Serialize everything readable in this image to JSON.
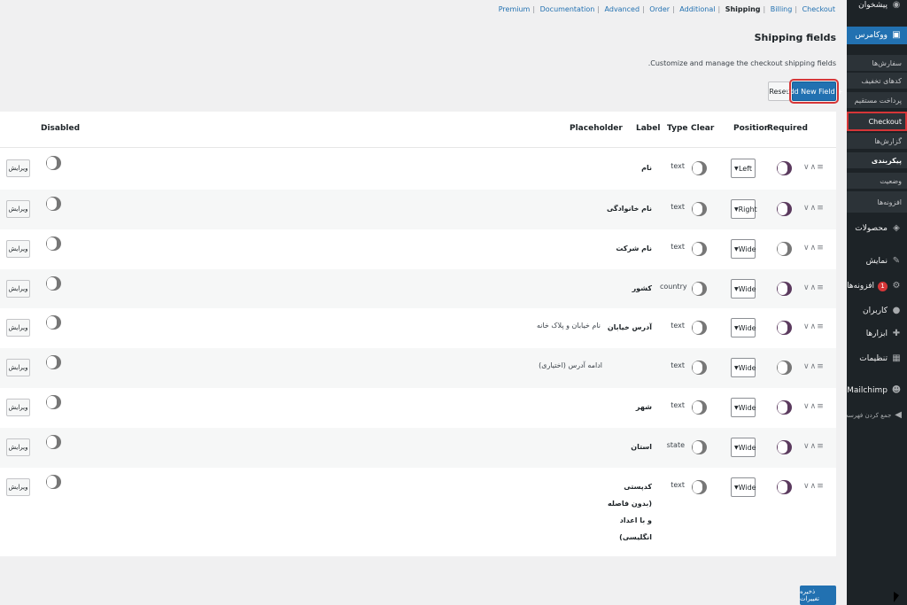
{
  "sidebar": {
    "top_item": "پیشخوان",
    "woo": "ووکامرس",
    "woo_sub": [
      "سفارش‌ها",
      "کدهای تخفیف",
      "پرداخت مستقیم",
      "Checkout",
      "گزارش‌ها",
      "پیکربندی",
      "وضعیت",
      "افزونه‌ها"
    ],
    "menu": [
      {
        "label": "محصولات",
        "icon": "archive-icon"
      },
      {
        "label": "نمایش",
        "icon": "brush-icon"
      },
      {
        "label": "افزونه‌ها",
        "icon": "plugin-icon",
        "badge": "1"
      },
      {
        "label": "کاربران",
        "icon": "user-icon"
      },
      {
        "label": "ابزارها",
        "icon": "wrench-icon"
      },
      {
        "label": "تنظیمات",
        "icon": "settings-icon"
      },
      {
        "label": "Mailchimp",
        "icon": "mailchimp-icon"
      },
      {
        "label": "جمع کردن فهرست",
        "icon": "collapse-icon"
      }
    ]
  },
  "nav": {
    "links": [
      "Premium",
      "Documentation",
      "Advanced",
      "Order",
      "Additional",
      "Shipping",
      "Billing",
      "Checkout"
    ],
    "current": "Shipping"
  },
  "page": {
    "title": "Shipping fields",
    "description": ".Customize and manage the checkout shipping fields",
    "reset": "Reset",
    "add_new": "Add New Field +",
    "save": "ذخیره تغییرات"
  },
  "table": {
    "headers": {
      "disabled": "Disabled",
      "placeholder": "Placeholder",
      "label": "Label",
      "type": "Type",
      "clear": "Clear",
      "position": "Position",
      "required": "Required"
    },
    "edit_label": "ویرایش",
    "rows": [
      {
        "label": "نام",
        "placeholder": "",
        "type": "text",
        "position": "Left",
        "required": true
      },
      {
        "label": "نام خانوادگی",
        "placeholder": "",
        "type": "text",
        "position": "Right",
        "required": true
      },
      {
        "label": "نام شرکت",
        "placeholder": "",
        "type": "text",
        "position": "Wide",
        "required": false
      },
      {
        "label": "کشور",
        "placeholder": "",
        "type": "country",
        "position": "Wide",
        "required": true
      },
      {
        "label": "آدرس خیابان",
        "placeholder": "نام خیابان و پلاک خانه",
        "type": "text",
        "position": "Wide",
        "required": true
      },
      {
        "label": "",
        "placeholder": "ادامه آدرس (اختیاری)",
        "type": "text",
        "position": "Wide",
        "required": false
      },
      {
        "label": "شهر",
        "placeholder": "",
        "type": "text",
        "position": "Wide",
        "required": true
      },
      {
        "label": "استان",
        "placeholder": "",
        "type": "state",
        "position": "Wide",
        "required": true
      },
      {
        "label": "کدپستی (بدون فاصله و با اعداد انگلیسی)",
        "placeholder": "",
        "type": "text",
        "position": "Wide",
        "required": true
      }
    ]
  }
}
